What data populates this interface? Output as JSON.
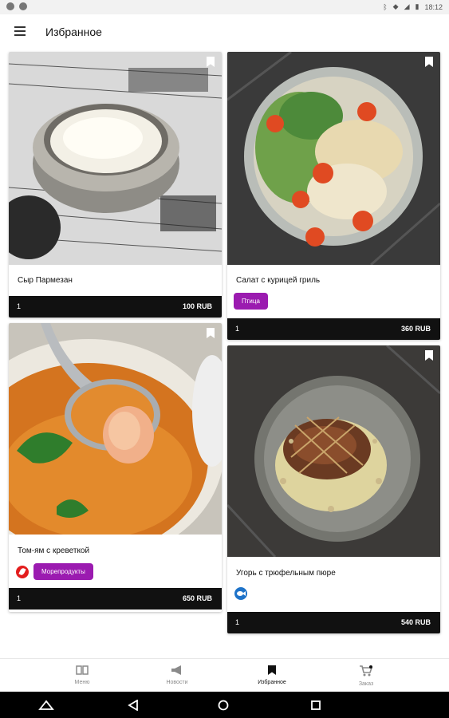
{
  "status_bar": {
    "time": "18:12"
  },
  "app_bar": {
    "title": "Избранное"
  },
  "items": [
    {
      "name": "Сыр Пармезан",
      "quantity": "1",
      "price": "100 RUB",
      "tags": [],
      "icons": []
    },
    {
      "name": "Салат с курицей гриль",
      "quantity": "1",
      "price": "360 RUB",
      "tags": [
        "Птица"
      ],
      "icons": []
    },
    {
      "name": "Том-ям с креветкой",
      "quantity": "1",
      "price": "650 RUB",
      "tags": [
        "Морепродукты"
      ],
      "icons": [
        "spicy-icon"
      ]
    },
    {
      "name": "Угорь с трюфельным пюре",
      "quantity": "1",
      "price": "540 RUB",
      "tags": [],
      "icons": [
        "fish-icon"
      ]
    }
  ],
  "bottom_nav": [
    {
      "label": "Меню",
      "icon": "book-icon",
      "active": false
    },
    {
      "label": "Новости",
      "icon": "megaphone-icon",
      "active": false
    },
    {
      "label": "Избранное",
      "icon": "bookmark-icon",
      "active": true
    },
    {
      "label": "Заказ",
      "icon": "cart-icon",
      "active": false
    }
  ],
  "colors": {
    "accent": "#9b1bb0",
    "bar": "#111111",
    "spicy": "#e31d1d",
    "fish": "#1e73c9"
  }
}
